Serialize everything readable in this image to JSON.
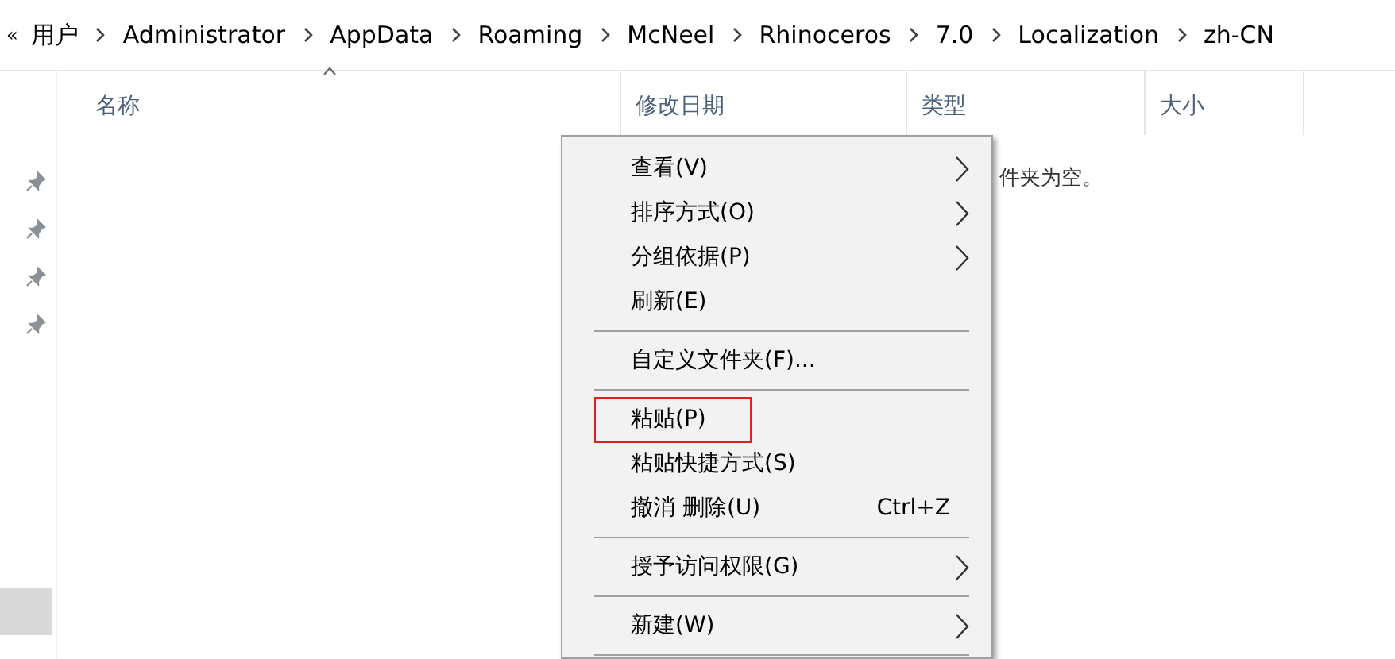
{
  "breadcrumb": {
    "overflow": "«",
    "parts": [
      "用户",
      "Administrator",
      "AppData",
      "Roaming",
      "McNeel",
      "Rhinoceros",
      "7.0",
      "Localization",
      "zh-CN"
    ]
  },
  "quick_access": [
    {
      "pinned": true
    },
    {
      "pinned": true
    },
    {
      "pinned": true
    },
    {
      "pinned": true
    }
  ],
  "columns": [
    {
      "label": "名称",
      "sorted": true
    },
    {
      "label": "修改日期",
      "sorted": false
    },
    {
      "label": "类型",
      "sorted": false
    },
    {
      "label": "大小",
      "sorted": false
    }
  ],
  "empty_message": "件夹为空。",
  "context_menu": [
    {
      "kind": "item",
      "label": "查看(V)",
      "submenu": true,
      "highlighted": false
    },
    {
      "kind": "item",
      "label": "排序方式(O)",
      "submenu": true,
      "highlighted": false
    },
    {
      "kind": "item",
      "label": "分组依据(P)",
      "submenu": true,
      "highlighted": false
    },
    {
      "kind": "item",
      "label": "刷新(E)",
      "submenu": false,
      "highlighted": false
    },
    {
      "kind": "separator"
    },
    {
      "kind": "item",
      "label": "自定义文件夹(F)...",
      "submenu": false,
      "highlighted": false
    },
    {
      "kind": "separator"
    },
    {
      "kind": "item",
      "label": "粘贴(P)",
      "submenu": false,
      "highlighted": true
    },
    {
      "kind": "item",
      "label": "粘贴快捷方式(S)",
      "submenu": false,
      "highlighted": false
    },
    {
      "kind": "item",
      "label": "撤消 删除(U)",
      "shortcut": "Ctrl+Z",
      "submenu": false,
      "highlighted": false
    },
    {
      "kind": "separator"
    },
    {
      "kind": "item",
      "label": "授予访问权限(G)",
      "submenu": true,
      "highlighted": false
    },
    {
      "kind": "separator"
    },
    {
      "kind": "item",
      "label": "新建(W)",
      "submenu": true,
      "highlighted": false
    },
    {
      "kind": "separator"
    }
  ]
}
